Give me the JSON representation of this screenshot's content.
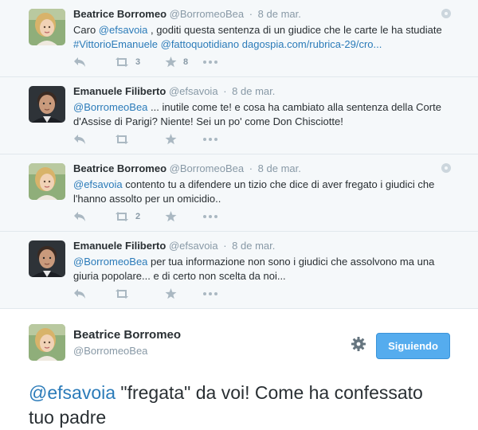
{
  "tweets": [
    {
      "fullname": "Beatrice Borromeo",
      "username": "@BorromeoBea",
      "time": "8 de mar.",
      "text_before": "Caro ",
      "mention": "@efsavoia",
      "text_middle": " , goditi questa sentenza di un giudice che le carte le ha studiate ",
      "hashtag": "#VittorioEmanuele",
      "mention2": "@fattoquotidiano",
      "url": "dagospia.com/rubrica-29/cro...",
      "retweet_count": "3",
      "favorite_count": "8"
    },
    {
      "fullname": "Emanuele Filiberto",
      "username": "@efsavoia",
      "time": "8 de mar.",
      "mention": "@BorromeoBea",
      "text": " ... inutile come te! e cosa ha cambiato alla sentenza della Corte d'Assise di Parigi? Niente! Sei un po' come Don Chisciotte!",
      "retweet_count": "",
      "favorite_count": ""
    },
    {
      "fullname": "Beatrice Borromeo",
      "username": "@BorromeoBea",
      "time": "8 de mar.",
      "mention": "@efsavoia",
      "text": " contento tu a difendere un tizio che dice di aver fregato i giudici che l'hanno assolto per un omicidio..",
      "retweet_count": "2",
      "favorite_count": ""
    },
    {
      "fullname": "Emanuele Filiberto",
      "username": "@efsavoia",
      "time": "8 de mar.",
      "mention": "@BorromeoBea",
      "text": " per tua informazione non sono i giudici che assolvono ma una giuria popolare... e di certo non scelta da noi...",
      "retweet_count": "",
      "favorite_count": ""
    }
  ],
  "separator": "·",
  "main_tweet": {
    "fullname": "Beatrice Borromeo",
    "username": "@BorromeoBea",
    "follow_label": "Siguiendo",
    "mention": "@efsavoia",
    "text": " \"fregata\" da voi! Come ha confessato tuo padre"
  },
  "icons": {
    "reply": "reply-icon",
    "retweet": "retweet-icon",
    "favorite": "star-icon",
    "more": "more-icon",
    "settings": "gear-icon"
  },
  "colors": {
    "link": "#2b7bb9",
    "button": "#55acee",
    "muted": "#8899a6",
    "thread_bg": "#f5f8fa"
  }
}
